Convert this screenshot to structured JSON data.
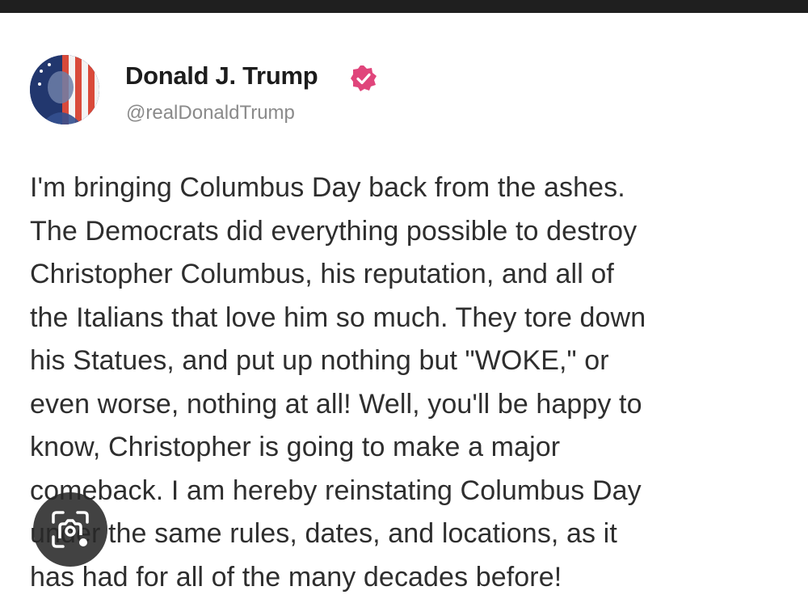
{
  "post": {
    "author": {
      "name": "Donald J. Trump",
      "handle": "@realDonaldTrump",
      "verified_badge_color": "#e0457b"
    },
    "text": "I'm bringing Columbus Day back from the ashes.\nThe Democrats did everything possible to destroy\nChristopher Columbus, his reputation, and all of\nthe Italians that love him so much. They tore down\nhis Statues, and put up nothing but \"WOKE,\" or\neven worse, nothing at all! Well, you'll be happy to\nknow, Christopher is going to make a major\ncomeback. I am hereby reinstating Columbus Day\nunder the same rules, dates, and locations, as it\nhas had for all of the many decades before!"
  },
  "overlay": {
    "icon": "visual-search-lens-icon"
  },
  "colors": {
    "top_bar": "#1f1f1f",
    "background": "#ffffff",
    "text": "#2e2e2e",
    "handle": "#8a8a8a"
  }
}
